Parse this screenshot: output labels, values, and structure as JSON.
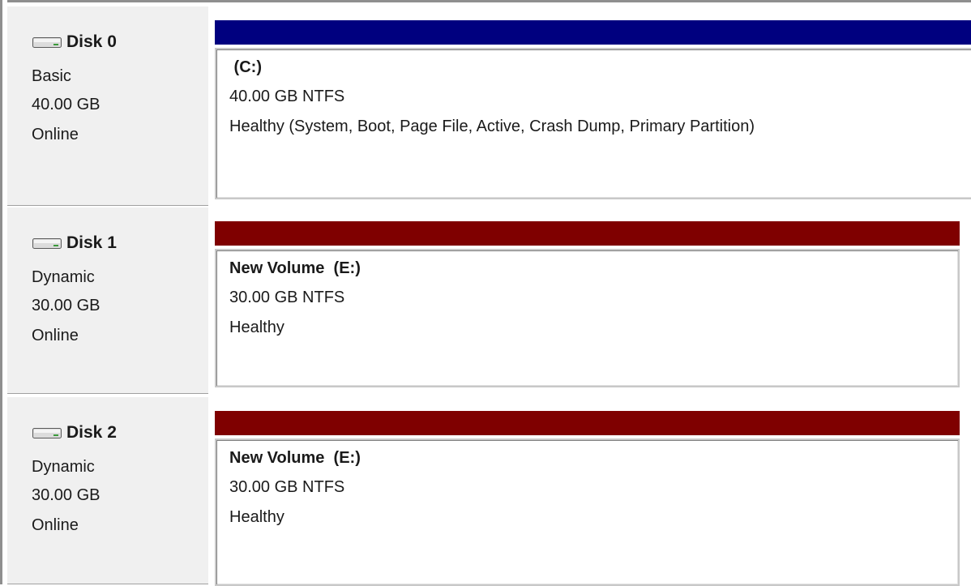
{
  "colors": {
    "basic_partition_bar": "#00007f",
    "dynamic_volume_bar": "#7f0000",
    "disk_info_background": "#f0f0f0"
  },
  "disks": [
    {
      "icon": "hard-disk-icon",
      "name": "Disk 0",
      "type": "Basic",
      "size": "40.00 GB",
      "status": "Online",
      "partition": {
        "title": " (C:)",
        "size_fs": "40.00 GB NTFS",
        "health": "Healthy (System, Boot, Page File, Active, Crash Dump, Primary Partition)",
        "bar_color": "#00007f"
      }
    },
    {
      "icon": "hard-disk-icon",
      "name": "Disk 1",
      "type": "Dynamic",
      "size": "30.00 GB",
      "status": "Online",
      "partition": {
        "title": "New Volume  (E:)",
        "size_fs": "30.00 GB NTFS",
        "health": "Healthy",
        "bar_color": "#7f0000"
      }
    },
    {
      "icon": "hard-disk-icon",
      "name": "Disk 2",
      "type": "Dynamic",
      "size": "30.00 GB",
      "status": "Online",
      "partition": {
        "title": "New Volume  (E:)",
        "size_fs": "30.00 GB NTFS",
        "health": "Healthy",
        "bar_color": "#7f0000"
      }
    }
  ]
}
